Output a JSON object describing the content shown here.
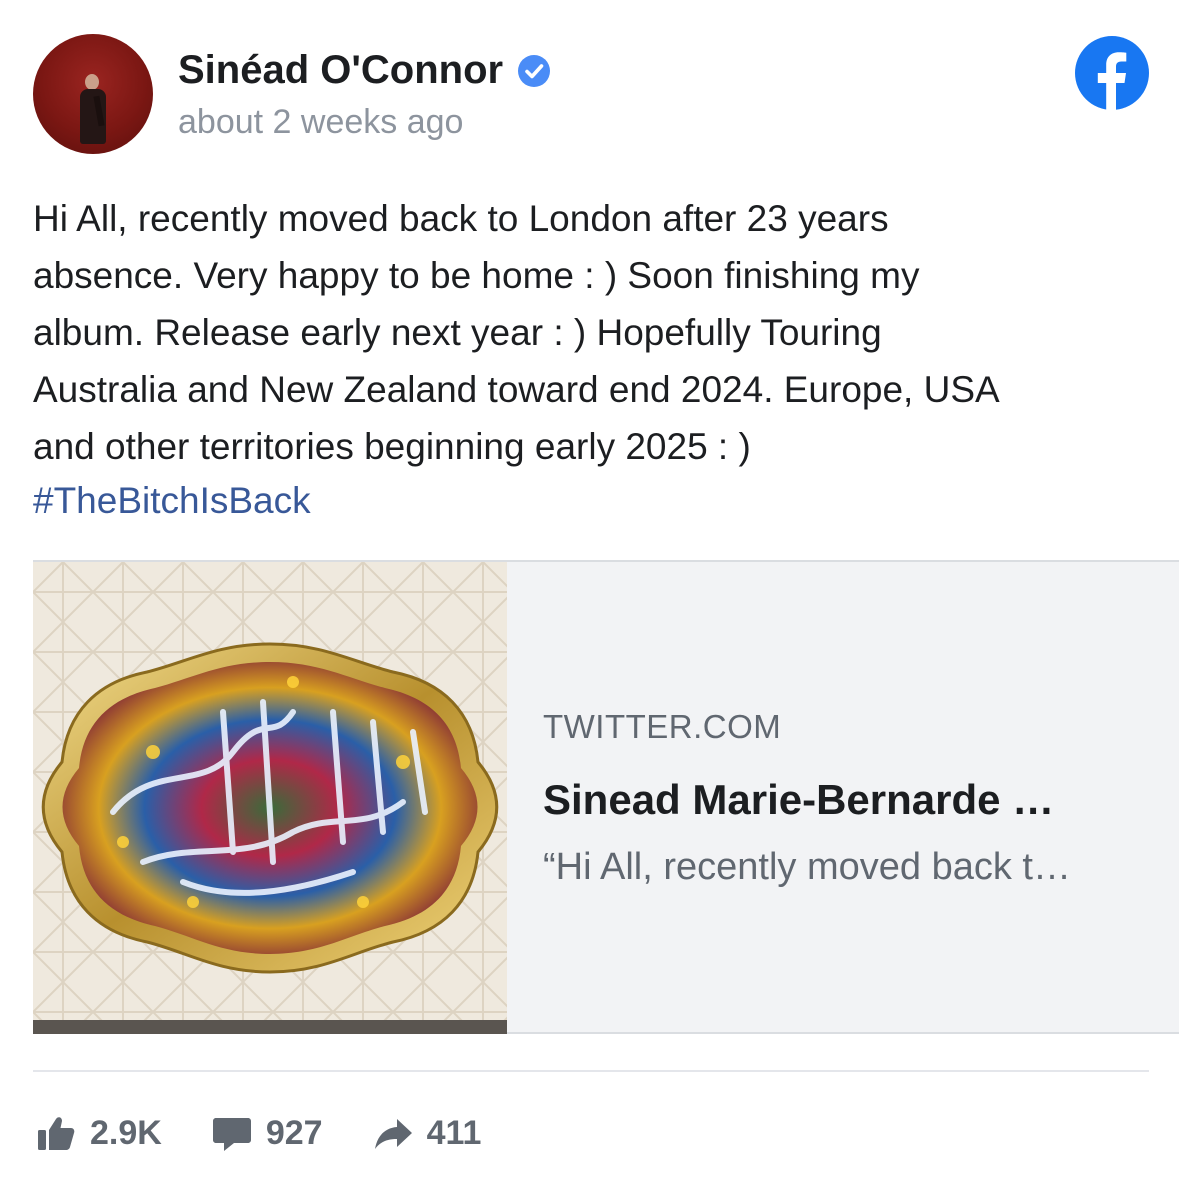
{
  "post": {
    "author": "Sinéad O'Connor",
    "timestamp": "about 2 weeks ago",
    "text_lines": [
      "Hi All, recently moved back to London after 23 years",
      "absence. Very happy to be home : ) Soon finishing my",
      "album. Release early next year : ) Hopefully Touring",
      "Australia and New Zealand toward end 2024. Europe, USA",
      "and other territories beginning early 2025 : )"
    ],
    "hashtag": "#TheBitchIsBack"
  },
  "link_card": {
    "domain": "TWITTER.COM",
    "title": "Sinead Marie-Bernarde …",
    "description": "“Hi All, recently moved back t…"
  },
  "stats": {
    "likes": "2.9K",
    "comments": "927",
    "shares": "411"
  },
  "colors": {
    "facebook_blue": "#1877f2",
    "hashtag": "#385898",
    "muted_text": "#8d949e",
    "card_bg": "#f2f3f5"
  },
  "icons": [
    "verified-badge-icon",
    "facebook-logo-icon",
    "like-icon",
    "comment-icon",
    "share-icon"
  ]
}
